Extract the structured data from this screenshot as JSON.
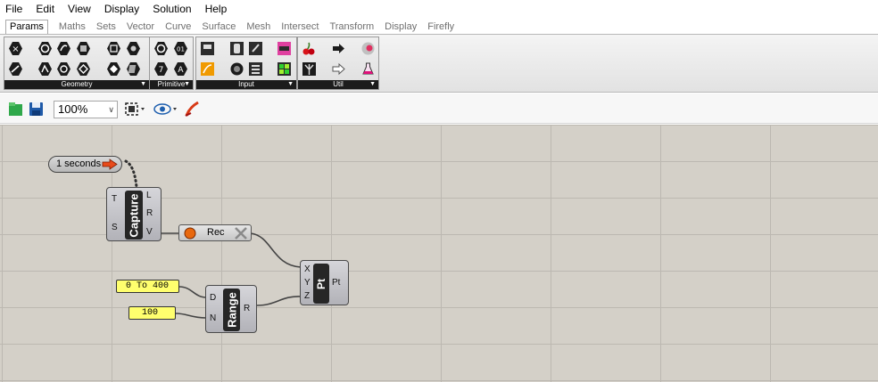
{
  "menu": [
    "File",
    "Edit",
    "View",
    "Display",
    "Solution",
    "Help"
  ],
  "tabs": [
    "Params",
    "Maths",
    "Sets",
    "Vector",
    "Curve",
    "Surface",
    "Mesh",
    "Intersect",
    "Transform",
    "Display",
    "Firefly"
  ],
  "ribbon_groups": [
    "Geometry",
    "Primitive",
    "Input",
    "Util"
  ],
  "toolbar": {
    "zoom": "100%"
  },
  "canvas": {
    "timer": {
      "label": "1 seconds"
    },
    "capture": {
      "name": "Capture",
      "inputs": [
        "T",
        "S"
      ],
      "outputs": [
        "L",
        "R",
        "V"
      ]
    },
    "recorder": {
      "label": "Rec"
    },
    "range": {
      "name": "Range",
      "inputs": [
        "D",
        "N"
      ],
      "outputs": [
        "R"
      ]
    },
    "point": {
      "name": "Pt",
      "inputs": [
        "X",
        "Y",
        "Z"
      ],
      "outputs": [
        "Pt"
      ]
    },
    "slider_domain": {
      "value": "0 To 400"
    },
    "slider_count": {
      "value": "100"
    }
  },
  "colors": {
    "canvas": "#d4d0c8",
    "slider": "#ffff6e",
    "component_core": "#262626"
  }
}
